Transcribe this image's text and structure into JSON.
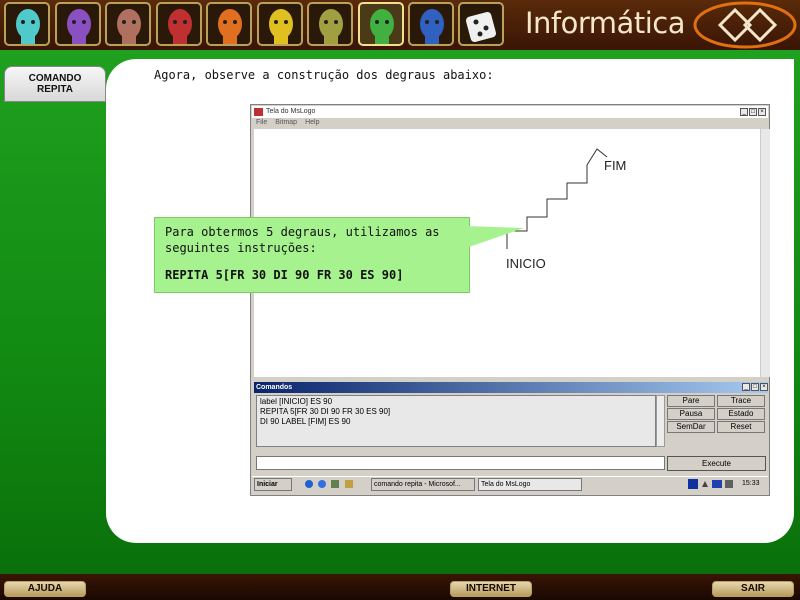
{
  "app": {
    "brand": "Informática"
  },
  "topic": {
    "tab_label": "COMANDO REPITA"
  },
  "content": {
    "intro": "Agora, observe a construção dos degraus abaixo:"
  },
  "callout": {
    "line1": "Para obtermos 5 degraus, utilizamos as",
    "line2": "seguintes instruções:",
    "code": "REPITA 5[FR 30 DI 90 FR 30 ES 90]"
  },
  "mslogo": {
    "window_title": "Tela do MsLogo",
    "menu": [
      "File",
      "Bitmap",
      "Help"
    ],
    "labels": {
      "fim": "FIM",
      "inicio": "INICIO"
    },
    "commands_title": "Comandos",
    "command_lines": [
      "label [INICIO] ES 90",
      "REPITA 5[FR 30 DI 90 FR 30 ES 90]",
      "DI 90 LABEL [FIM] ES 90"
    ],
    "buttons": {
      "pare": "Pare",
      "trace": "Trace",
      "pausa": "Pausa",
      "estado": "Estado",
      "semdar": "SemDar",
      "reset": "Reset",
      "execute": "Execute"
    }
  },
  "taskbar": {
    "start": "Iniciar",
    "task1": "comando repita - Microsof...",
    "task2": "Tela do MsLogo",
    "clock": "15:33"
  },
  "footer": {
    "ajuda": "AJUDA",
    "internet": "INTERNET",
    "sair": "SAIR"
  },
  "colors": {
    "green": "#1fa01f",
    "callout": "#a6f28e",
    "topbar": "#5a2a0a"
  }
}
